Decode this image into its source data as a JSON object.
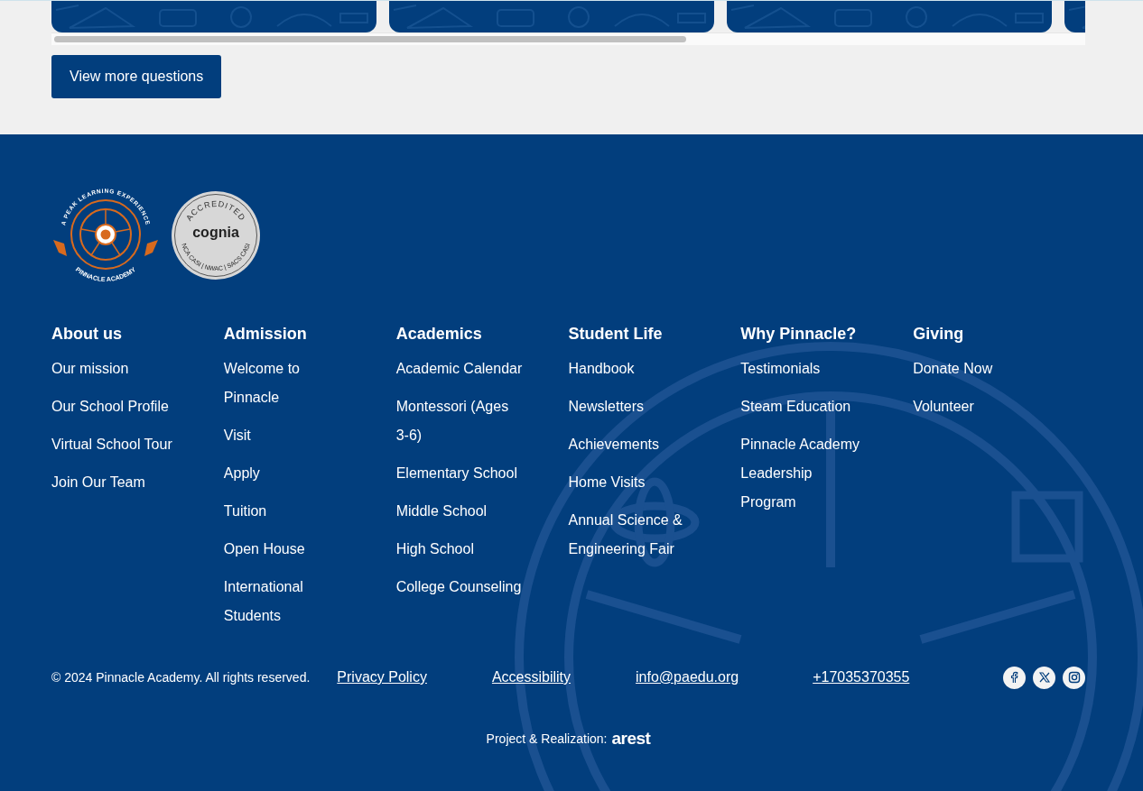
{
  "view_more_button": "View more questions",
  "footer": {
    "badges": [
      {
        "kind": "academy",
        "arc_top": "A PEAK LEARNING EXPERIENCE",
        "arc_bottom": "PINNACLE ACADEMY"
      },
      {
        "kind": "accreditation",
        "arc_top": "ACCREDITED",
        "name": "cognia",
        "arc_bottom": "NCA CASI | NWAC | SACS CASI"
      }
    ],
    "columns": [
      {
        "heading": "About us",
        "links": [
          "Our mission",
          "Our School Profile",
          "Virtual School Tour",
          "Join Our Team"
        ]
      },
      {
        "heading": "Admission",
        "links": [
          "Welcome to Pinnacle",
          "Visit",
          "Apply",
          "Tuition",
          "Open House",
          "International Students"
        ]
      },
      {
        "heading": "Academics",
        "links": [
          "Academic Calendar",
          "Montessori (Ages 3-6)",
          "Elementary School",
          "Middle School",
          "High School",
          "College Counseling"
        ]
      },
      {
        "heading": "Student Life",
        "links": [
          "Handbook",
          "Newsletters",
          "Achievements",
          "Home Visits",
          "Annual Science & Engineering Fair"
        ]
      },
      {
        "heading": "Why Pinnacle?",
        "links": [
          "Testimonials",
          "Steam Education",
          "Pinnacle Academy Leadership Program"
        ]
      },
      {
        "heading": "Giving",
        "links": [
          "Donate Now",
          "Volunteer"
        ]
      }
    ],
    "copyright": "© 2024 Pinnacle Academy. All rights reserved.",
    "bottom_links": [
      "Privacy Policy",
      "Accessibility",
      "info@paedu.org",
      "+17035370355"
    ],
    "social": [
      {
        "kind": "facebook"
      },
      {
        "kind": "x"
      },
      {
        "kind": "instagram"
      }
    ],
    "credit": {
      "label": "Project & Realization:",
      "brand": "arest"
    }
  }
}
